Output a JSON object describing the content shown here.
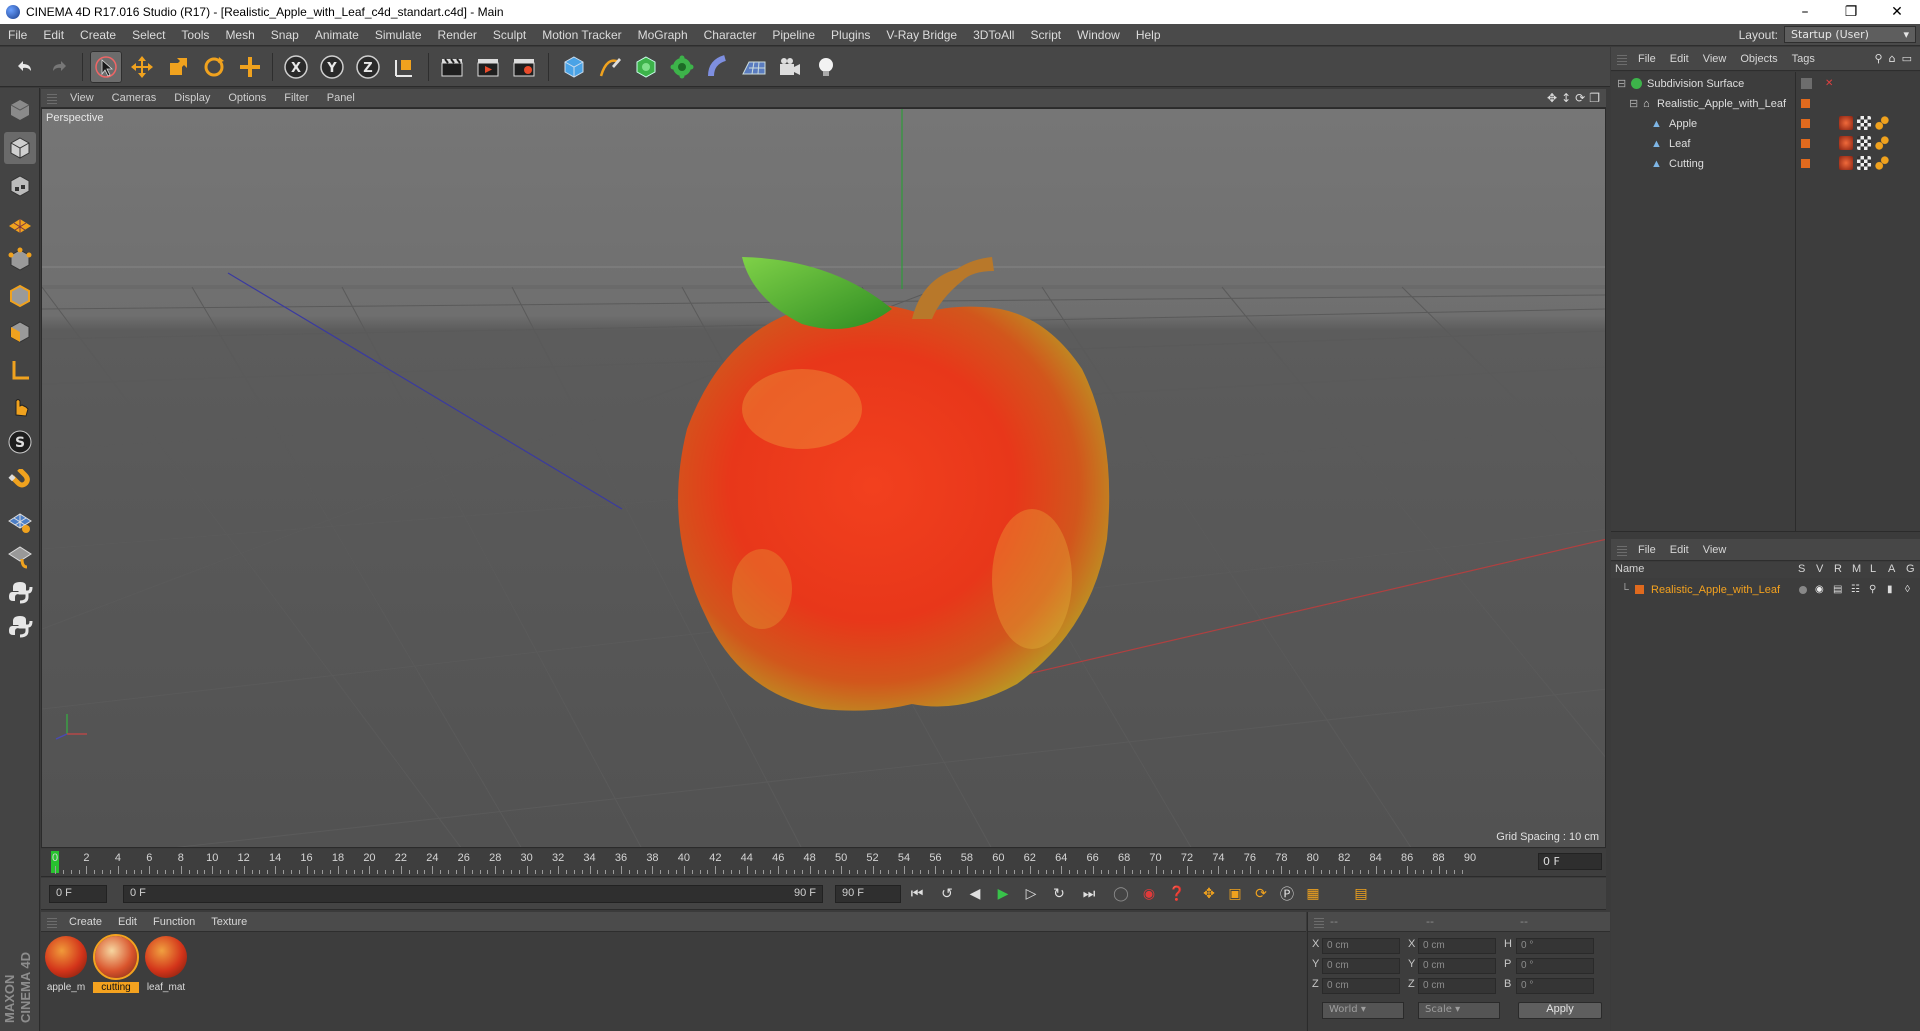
{
  "window": {
    "title": "CINEMA 4D R17.016 Studio (R17) - [Realistic_Apple_with_Leaf_c4d_standart.c4d] - Main",
    "minimize": "–",
    "restore": "❐",
    "close": "✕"
  },
  "menubar": {
    "items": [
      "File",
      "Edit",
      "Create",
      "Select",
      "Tools",
      "Mesh",
      "Snap",
      "Animate",
      "Simulate",
      "Render",
      "Sculpt",
      "Motion Tracker",
      "MoGraph",
      "Character",
      "Pipeline",
      "Plugins",
      "V-Ray Bridge",
      "3DToAll",
      "Script",
      "Window",
      "Help"
    ],
    "layout_label": "Layout:",
    "layout_value": "Startup (User)"
  },
  "viewport": {
    "menu": [
      "View",
      "Cameras",
      "Display",
      "Options",
      "Filter",
      "Panel"
    ],
    "camera_label": "Perspective",
    "grid_spacing": "Grid Spacing : 10 cm"
  },
  "timeline": {
    "ticks": [
      "0",
      "2",
      "4",
      "6",
      "8",
      "10",
      "12",
      "14",
      "16",
      "18",
      "20",
      "22",
      "24",
      "26",
      "28",
      "30",
      "32",
      "34",
      "36",
      "38",
      "40",
      "42",
      "44",
      "46",
      "48",
      "50",
      "52",
      "54",
      "56",
      "58",
      "60",
      "62",
      "64",
      "66",
      "68",
      "70",
      "72",
      "74",
      "76",
      "78",
      "80",
      "82",
      "84",
      "86",
      "88",
      "90"
    ],
    "current_frame": "0 F"
  },
  "transport": {
    "start_field": "0 F",
    "range_start": "0 F",
    "range_end": "90 F",
    "end_field": "90 F"
  },
  "materials": {
    "menu": [
      "Create",
      "Edit",
      "Function",
      "Texture"
    ],
    "items": [
      {
        "name": "apple_m",
        "selected": false
      },
      {
        "name": "cutting",
        "selected": true
      },
      {
        "name": "leaf_mat",
        "selected": false
      }
    ]
  },
  "coords": {
    "header": [
      "--",
      "--",
      "--"
    ],
    "rows": [
      {
        "l1": "X",
        "v1": "0 cm",
        "l2": "X",
        "v2": "0 cm",
        "l3": "H",
        "v3": "0 °"
      },
      {
        "l1": "Y",
        "v1": "0 cm",
        "l2": "Y",
        "v2": "0 cm",
        "l3": "P",
        "v3": "0 °"
      },
      {
        "l1": "Z",
        "v1": "0 cm",
        "l2": "Z",
        "v2": "0 cm",
        "l3": "B",
        "v3": "0 °"
      }
    ],
    "space": "World",
    "mode": "Scale",
    "apply": "Apply"
  },
  "object_manager": {
    "menu": [
      "File",
      "Edit",
      "View",
      "Objects",
      "Tags"
    ],
    "objects": [
      {
        "name": "Subdivision Surface",
        "indent": 0
      },
      {
        "name": "Realistic_Apple_with_Leaf",
        "indent": 1
      },
      {
        "name": "Apple",
        "indent": 2
      },
      {
        "name": "Leaf",
        "indent": 2
      },
      {
        "name": "Cutting",
        "indent": 2
      }
    ]
  },
  "layer_manager": {
    "menu": [
      "File",
      "Edit",
      "View"
    ],
    "col_name": "Name",
    "cols": [
      "S",
      "V",
      "R",
      "M",
      "L",
      "A",
      "G"
    ],
    "layer_name": "Realistic_Apple_with_Leaf"
  },
  "colors": {
    "accent_orange": "#f4a21f",
    "layer_orange": "#e06a1e",
    "timeline_green": "#27c22f"
  }
}
